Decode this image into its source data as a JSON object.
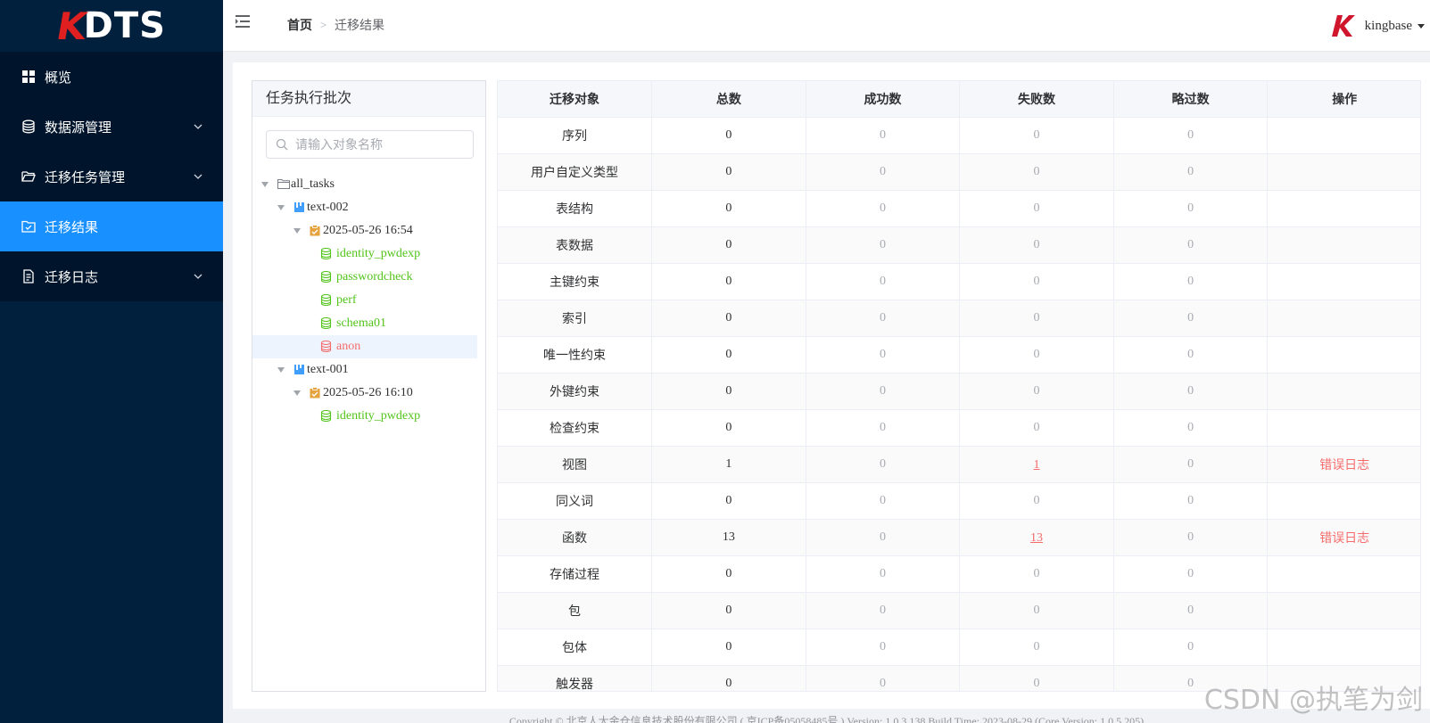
{
  "app": {
    "logo_text": "DTS",
    "logo_k": "K"
  },
  "sidebar": {
    "items": [
      {
        "label": "概览",
        "icon": "grid-icon",
        "active": false,
        "has_submenu": false
      },
      {
        "label": "数据源管理",
        "icon": "database-icon",
        "active": false,
        "has_submenu": true
      },
      {
        "label": "迁移任务管理",
        "icon": "folder-open-icon",
        "active": false,
        "has_submenu": true
      },
      {
        "label": "迁移结果",
        "icon": "folder-check-icon",
        "active": true,
        "has_submenu": false
      },
      {
        "label": "迁移日志",
        "icon": "document-icon",
        "active": false,
        "has_submenu": true
      }
    ]
  },
  "header": {
    "breadcrumb_home": "首页",
    "breadcrumb_separator": ">",
    "breadcrumb_current": "迁移结果",
    "user_name": "kingbase"
  },
  "tree_panel": {
    "title": "任务执行批次",
    "search_placeholder": "请输入对象名称",
    "nodes": [
      {
        "label": "all_tasks",
        "level": 0,
        "icon": "folder-icon"
      },
      {
        "label": "text-002",
        "level": 1,
        "icon": "task-icon"
      },
      {
        "label": "2025-05-26 16:54",
        "level": 2,
        "icon": "clipboard-icon"
      },
      {
        "label": "identity_pwdexp",
        "level": 3,
        "icon": "schema-icon",
        "status": "success"
      },
      {
        "label": "passwordcheck",
        "level": 3,
        "icon": "schema-icon",
        "status": "success"
      },
      {
        "label": "perf",
        "level": 3,
        "icon": "schema-icon",
        "status": "success"
      },
      {
        "label": "schema01",
        "level": 3,
        "icon": "schema-icon",
        "status": "success"
      },
      {
        "label": "anon",
        "level": 3,
        "icon": "schema-icon",
        "status": "failed",
        "selected": true
      },
      {
        "label": "text-001",
        "level": 1,
        "icon": "task-icon"
      },
      {
        "label": "2025-05-26 16:10",
        "level": 2,
        "icon": "clipboard-icon"
      },
      {
        "label": "identity_pwdexp",
        "level": 3,
        "icon": "schema-icon",
        "status": "success"
      }
    ]
  },
  "table": {
    "columns": [
      "迁移对象",
      "总数",
      "成功数",
      "失败数",
      "略过数",
      "操作"
    ],
    "rows": [
      {
        "object": "序列",
        "total": "0",
        "success": "0",
        "failed": "0",
        "skipped": "0",
        "action": ""
      },
      {
        "object": "用户自定义类型",
        "total": "0",
        "success": "0",
        "failed": "0",
        "skipped": "0",
        "action": ""
      },
      {
        "object": "表结构",
        "total": "0",
        "success": "0",
        "failed": "0",
        "skipped": "0",
        "action": ""
      },
      {
        "object": "表数据",
        "total": "0",
        "success": "0",
        "failed": "0",
        "skipped": "0",
        "action": ""
      },
      {
        "object": "主键约束",
        "total": "0",
        "success": "0",
        "failed": "0",
        "skipped": "0",
        "action": ""
      },
      {
        "object": "索引",
        "total": "0",
        "success": "0",
        "failed": "0",
        "skipped": "0",
        "action": ""
      },
      {
        "object": "唯一性约束",
        "total": "0",
        "success": "0",
        "failed": "0",
        "skipped": "0",
        "action": ""
      },
      {
        "object": "外键约束",
        "total": "0",
        "success": "0",
        "failed": "0",
        "skipped": "0",
        "action": ""
      },
      {
        "object": "检查约束",
        "total": "0",
        "success": "0",
        "failed": "0",
        "skipped": "0",
        "action": ""
      },
      {
        "object": "视图",
        "total": "1",
        "success": "0",
        "failed": "1",
        "skipped": "0",
        "action": "错误日志"
      },
      {
        "object": "同义词",
        "total": "0",
        "success": "0",
        "failed": "0",
        "skipped": "0",
        "action": ""
      },
      {
        "object": "函数",
        "total": "13",
        "success": "0",
        "failed": "13",
        "skipped": "0",
        "action": "错误日志"
      },
      {
        "object": "存储过程",
        "total": "0",
        "success": "0",
        "failed": "0",
        "skipped": "0",
        "action": ""
      },
      {
        "object": "包",
        "total": "0",
        "success": "0",
        "failed": "0",
        "skipped": "0",
        "action": ""
      },
      {
        "object": "包体",
        "total": "0",
        "success": "0",
        "failed": "0",
        "skipped": "0",
        "action": ""
      },
      {
        "object": "触发器",
        "total": "0",
        "success": "0",
        "failed": "0",
        "skipped": "0",
        "action": ""
      }
    ]
  },
  "footer": {
    "text": "Copyright © 北京人大金仓信息技术股份有限公司 ( 京ICP备05058485号 ) Version: 1.0.3.138 Build Time: 2023-08-29 (Core Version: 1.0.5.205)"
  },
  "watermark": {
    "text": "CSDN @执笔为剑"
  },
  "colors": {
    "sidebar_bg": "#00203e",
    "active_menu": "#1890ff",
    "success": "#52c41a",
    "failed": "#f56c6c",
    "logo_red": "#e02020"
  }
}
